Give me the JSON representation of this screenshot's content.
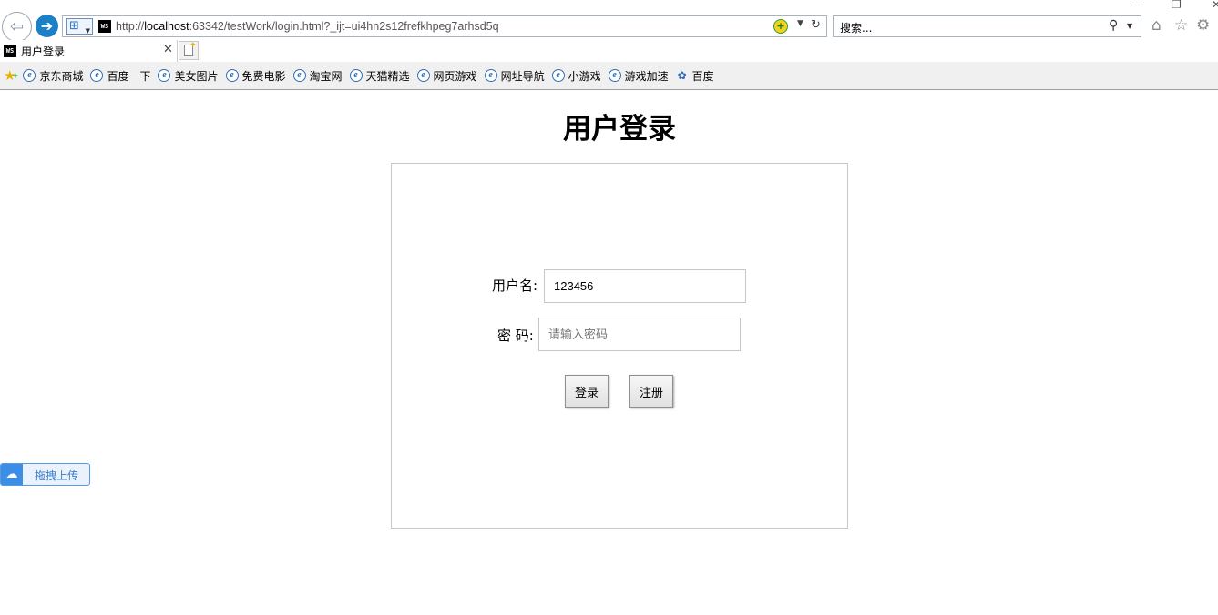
{
  "browser": {
    "window_controls": {
      "minimize": "—",
      "restore": "❐",
      "close": "✕"
    },
    "url_host_prefix": "http://",
    "url_host": "localhost",
    "url_rest": ":63342/testWork/login.html?_ijt=ui4hn2s12frefkhpeg7arhsd5q",
    "search_placeholder": "搜索...",
    "tab_title": "用户登录",
    "favicon_text": "WS",
    "favorites": [
      {
        "label": "京东商城",
        "icon": "ie-icon"
      },
      {
        "label": "百度一下",
        "icon": "ie-icon"
      },
      {
        "label": "美女图片",
        "icon": "ie-icon"
      },
      {
        "label": "免费电影",
        "icon": "ie-icon"
      },
      {
        "label": "淘宝网",
        "icon": "ie-icon"
      },
      {
        "label": "天猫精选",
        "icon": "ie-icon"
      },
      {
        "label": "网页游戏",
        "icon": "ie-icon"
      },
      {
        "label": "网址导航",
        "icon": "ie-icon"
      },
      {
        "label": "小游戏",
        "icon": "ie-icon"
      },
      {
        "label": "游戏加速",
        "icon": "ie-icon"
      },
      {
        "label": "百度",
        "icon": "paw-icon"
      }
    ]
  },
  "page": {
    "title": "用户登录",
    "username_label": "用户名:",
    "username_value": "123456",
    "password_label": "密 码:",
    "password_placeholder": "请输入密码",
    "login_button": "登录",
    "register_button": "注册"
  },
  "upload_widget": {
    "label": "拖拽上传"
  }
}
